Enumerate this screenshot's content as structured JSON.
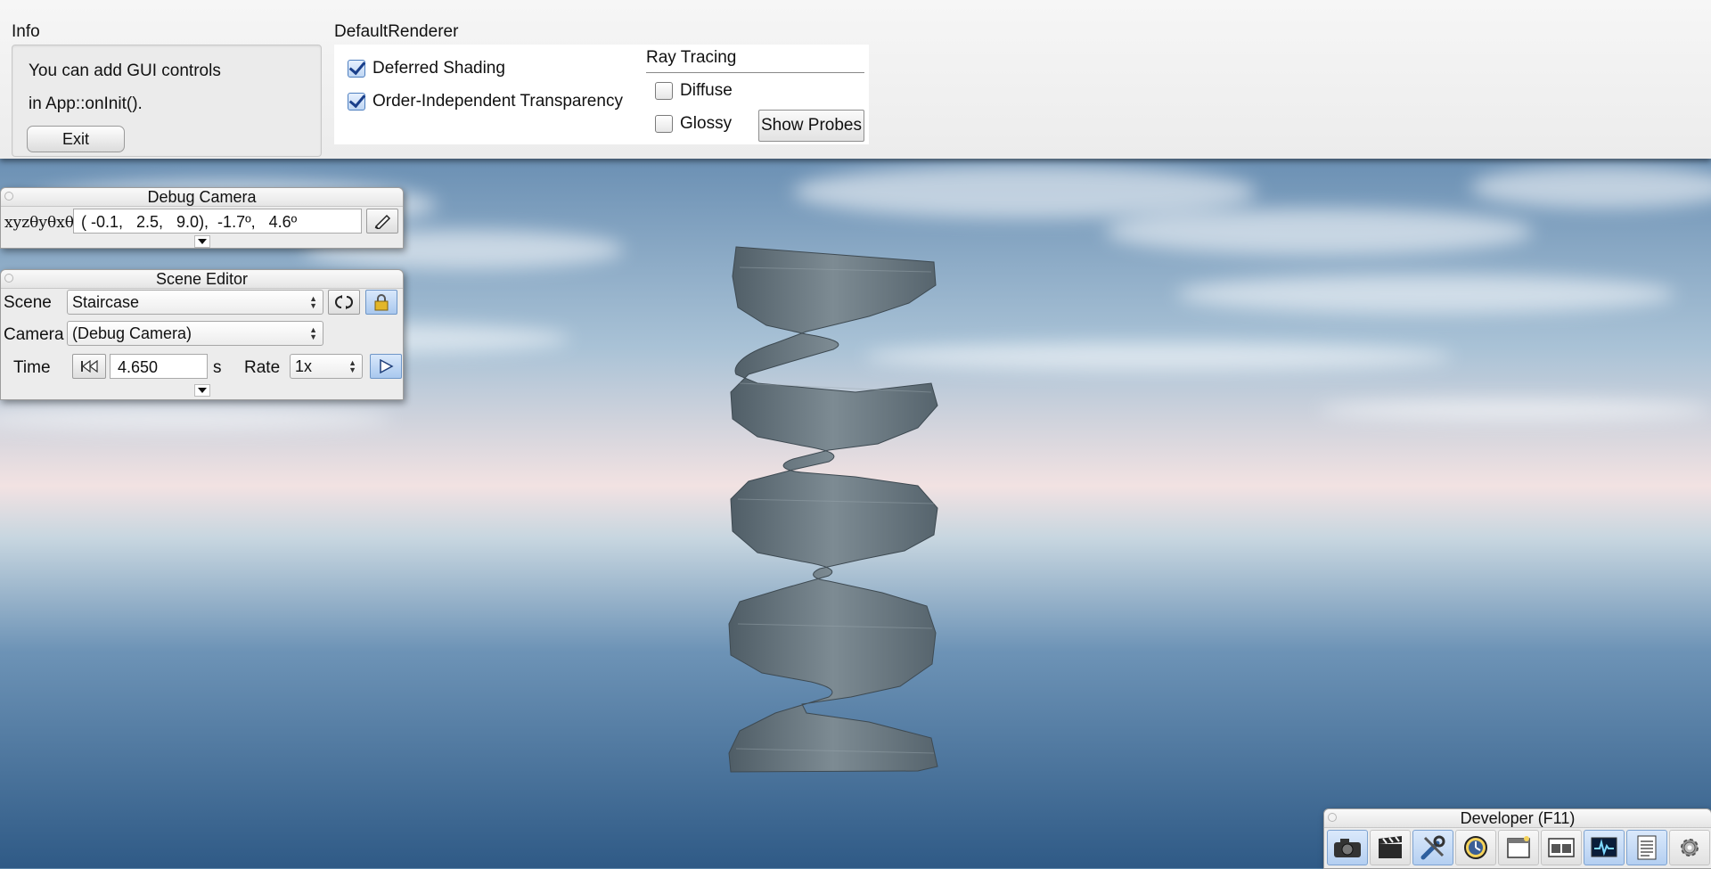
{
  "info": {
    "caption": "Info",
    "line1": "You can add GUI controls",
    "line2": "in App::onInit().",
    "exit_label": "Exit"
  },
  "renderer": {
    "caption": "DefaultRenderer",
    "deferred_shading": {
      "label": "Deferred Shading",
      "checked": true
    },
    "oit": {
      "label": "Order-Independent Transparency",
      "checked": true
    },
    "ray_tracing": {
      "caption": "Ray Tracing",
      "diffuse": {
        "label": "Diffuse",
        "checked": false
      },
      "glossy": {
        "label": "Glossy",
        "checked": false
      },
      "show_probes_label": "Show Probes"
    }
  },
  "debug_camera": {
    "title": "Debug Camera",
    "coord_label": "xyzθyθxθz",
    "coord_value": "( -0.1,   2.5,   9.0),  -1.7º,   4.6º",
    "bookmark_icon": "bookmark-pencil-icon"
  },
  "scene_editor": {
    "title": "Scene Editor",
    "scene_label": "Scene",
    "scene_value": "Staircase",
    "camera_label": "Camera",
    "camera_value": "(Debug Camera)",
    "time_label": "Time",
    "time_value": "4.650",
    "time_unit": "s",
    "rate_label": "Rate",
    "rate_value": "1x",
    "icons": [
      "reload-icon",
      "lock-icon",
      "rewind-icon",
      "play-icon"
    ]
  },
  "developer": {
    "title": "Developer (F11)",
    "icons": [
      "camera-icon",
      "film-clapper-icon",
      "tools-icon",
      "profiler-clock-icon",
      "window-icon",
      "scene-windows-icon",
      "performance-monitor-icon",
      "log-document-icon",
      "settings-gear-icon"
    ]
  },
  "colors": {
    "sky_top": "#3d6590",
    "horizon": "#f2e2e2",
    "ground": "#2f5a86",
    "staircase": "#6e7c85",
    "gui_bg": "#ececec",
    "check_blue": "#4e7fbf"
  }
}
